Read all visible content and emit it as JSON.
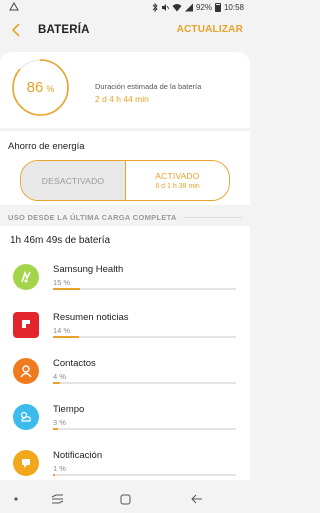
{
  "status_bar": {
    "battery_percent": "92%",
    "time": "10:58",
    "icons": [
      "notification-icon",
      "bluetooth-icon",
      "mute-icon",
      "wifi-icon",
      "signal-icon",
      "battery-icon"
    ]
  },
  "header": {
    "title": "BATERÍA",
    "action": "ACTUALIZAR",
    "back_icon": "chevron-left-icon"
  },
  "battery": {
    "level_number": "86",
    "level_unit": "%",
    "level_fraction": 0.86,
    "estimate_label": "Duración estimada de la batería",
    "estimate_value": "2 d 4 h 44 min"
  },
  "power_saving": {
    "label": "Ahorro de energía",
    "off_label": "DESACTIVADO",
    "on_label": "ACTIVADO",
    "on_value": "6 d 1 h 38 min",
    "selected": "on"
  },
  "usage": {
    "section_title": "USO DESDE LA ÚLTIMA CARGA COMPLETA",
    "time_on_battery": "1h 46m 49s de batería",
    "apps": [
      {
        "name": "Samsung Health",
        "percent": "15 %",
        "fraction": 0.15,
        "icon": "samsung-health-icon",
        "color": "#a4d44a"
      },
      {
        "name": "Resumen noticias",
        "percent": "14 %",
        "fraction": 0.14,
        "icon": "flipboard-icon",
        "color": "#e2262b"
      },
      {
        "name": "Contactos",
        "percent": "4 %",
        "fraction": 0.04,
        "icon": "contacts-icon",
        "color": "#f07a1e"
      },
      {
        "name": "Tiempo",
        "percent": "3 %",
        "fraction": 0.03,
        "icon": "weather-icon",
        "color": "#3bbcec"
      },
      {
        "name": "Notificación",
        "percent": "1 %",
        "fraction": 0.01,
        "icon": "notification-app-icon",
        "color": "#f2a81d"
      }
    ]
  },
  "colors": {
    "accent": "#e8a32a",
    "background": "#f3f3f3",
    "card": "#ffffff"
  },
  "nav_bar": {
    "icons": [
      "dot-icon",
      "recent-apps-icon",
      "home-icon",
      "back-arrow-icon"
    ]
  }
}
